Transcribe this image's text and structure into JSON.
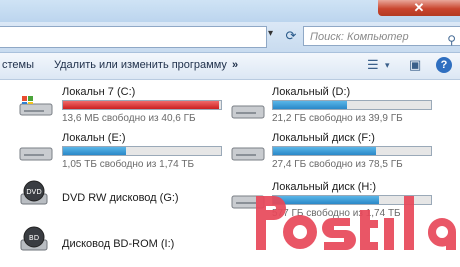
{
  "address_bar": {
    "search_placeholder": "Поиск: Компьютер"
  },
  "toolbar": {
    "system_label": "стемы",
    "uninstall_label": "Удалить или изменить программу",
    "more_label": "»",
    "help_label": "?"
  },
  "drives": [
    {
      "name": "Локальн 7 (C:)",
      "free": "13,6 МБ свободно из 40,6 ГБ",
      "used_fraction": 0.99,
      "status": "red"
    },
    {
      "name": "Локальный (D:)",
      "free": "21,2 ГБ свободно из 39,9 ГБ",
      "used_fraction": 0.47,
      "status": "normal"
    },
    {
      "name": "Локальн (E:)",
      "free": "1,05 ТБ свободно из 1,74 ТБ",
      "used_fraction": 0.4,
      "status": "normal"
    },
    {
      "name": "Локальный диск (F:)",
      "free": "27,4 ГБ свободно из 78,5 ГБ",
      "used_fraction": 0.65,
      "status": "normal"
    },
    {
      "name": "DVD RW дисковод (G:)",
      "free": "",
      "used_fraction": null,
      "status": "optical"
    },
    {
      "name": "Локальный диск (H:)",
      "free": "577 ГБ свободно из 1,74 ТБ",
      "used_fraction": 0.67,
      "status": "normal"
    },
    {
      "name": "Дисковод BD-ROM (I:)",
      "free": "",
      "used_fraction": null,
      "status": "optical"
    }
  ],
  "colors": {
    "bar_normal": "#2a88c8",
    "bar_full": "#cc1f1f",
    "watermark": "#e8485a"
  }
}
